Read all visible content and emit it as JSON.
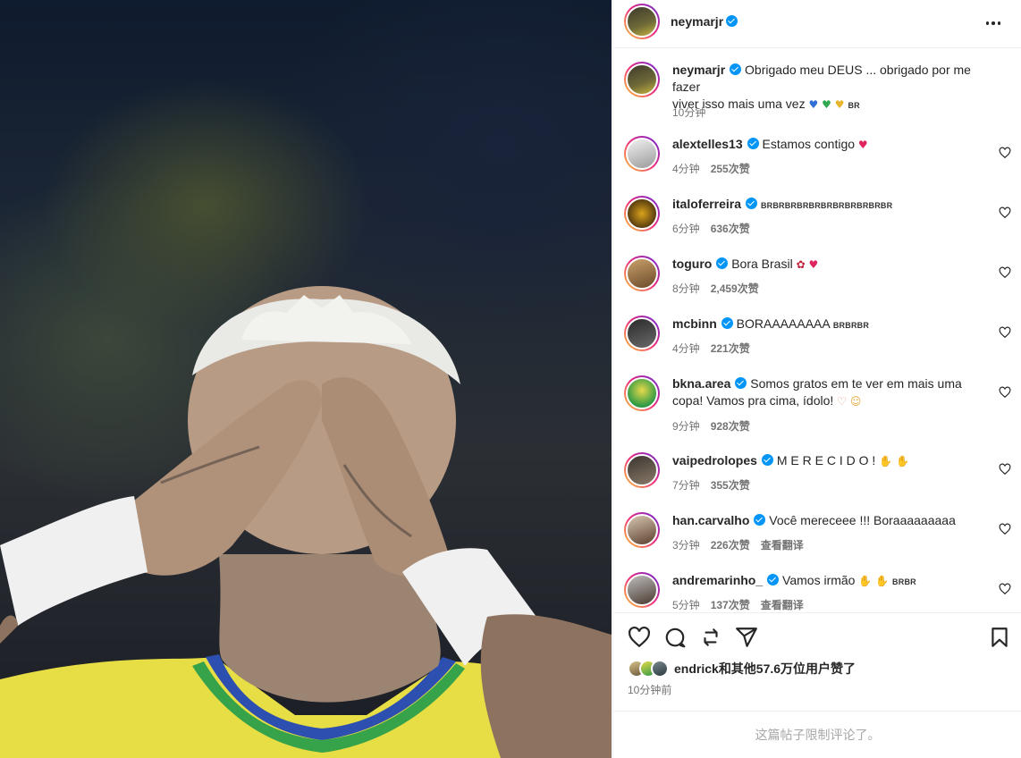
{
  "post": {
    "author": "neymarjr",
    "caption_line1": "Obrigado meu DEUS ... obrigado por me fazer",
    "caption_line2": "viver isso mais uma vez",
    "caption_flag": "BR",
    "caption_time": "10分钟",
    "likers_prefix": "endrick",
    "likers_text": "和其他57.6万位用户赞了",
    "post_time": "10分钟前",
    "comments_limited": "这篇帖子限制评论了。"
  },
  "comments": [
    {
      "user": "alextelles13",
      "text": "Estamos contigo",
      "time": "4分钟",
      "likes": "255次赞",
      "translate": ""
    },
    {
      "user": "italoferreira",
      "text": "",
      "flags": "BRBRBRBRBRBRBRBRBRBRBR",
      "time": "6分钟",
      "likes": "636次赞",
      "translate": ""
    },
    {
      "user": "toguro",
      "text": "Bora Brasil",
      "time": "8分钟",
      "likes": "2,459次赞",
      "translate": ""
    },
    {
      "user": "mcbinn",
      "text": "BORAAAAAAAA",
      "flags": "BRBRBR",
      "time": "4分钟",
      "likes": "221次赞",
      "translate": ""
    },
    {
      "user": "bkna.area",
      "text": "Somos gratos em te ver em mais uma",
      "text2": "copa! Vamos pra cima, ídolo!",
      "time": "9分钟",
      "likes": "928次赞",
      "translate": ""
    },
    {
      "user": "vaipedrolopes",
      "text": "M E R E C I D O !",
      "time": "7分钟",
      "likes": "355次赞",
      "translate": ""
    },
    {
      "user": "han.carvalho",
      "text": "Você mereceee !!! Boraaaaaaaaa",
      "time": "3分钟",
      "likes": "226次赞",
      "translate": "查看翻译"
    },
    {
      "user": "andremarinho_",
      "text": "Vamos irmão",
      "flags": "BRBR",
      "time": "5分钟",
      "likes": "137次赞",
      "translate": "查看翻译"
    }
  ],
  "icons": {
    "like": "heart-icon",
    "comment": "comment-icon",
    "share": "share-icon",
    "send": "send-icon",
    "save": "bookmark-icon",
    "more": "more-icon"
  },
  "colors": {
    "verified": "#0095f6",
    "text_primary": "#262626",
    "text_secondary": "#737373",
    "story_ring": "#ee2a7b",
    "jersey_yellow": "#e6d94a"
  }
}
